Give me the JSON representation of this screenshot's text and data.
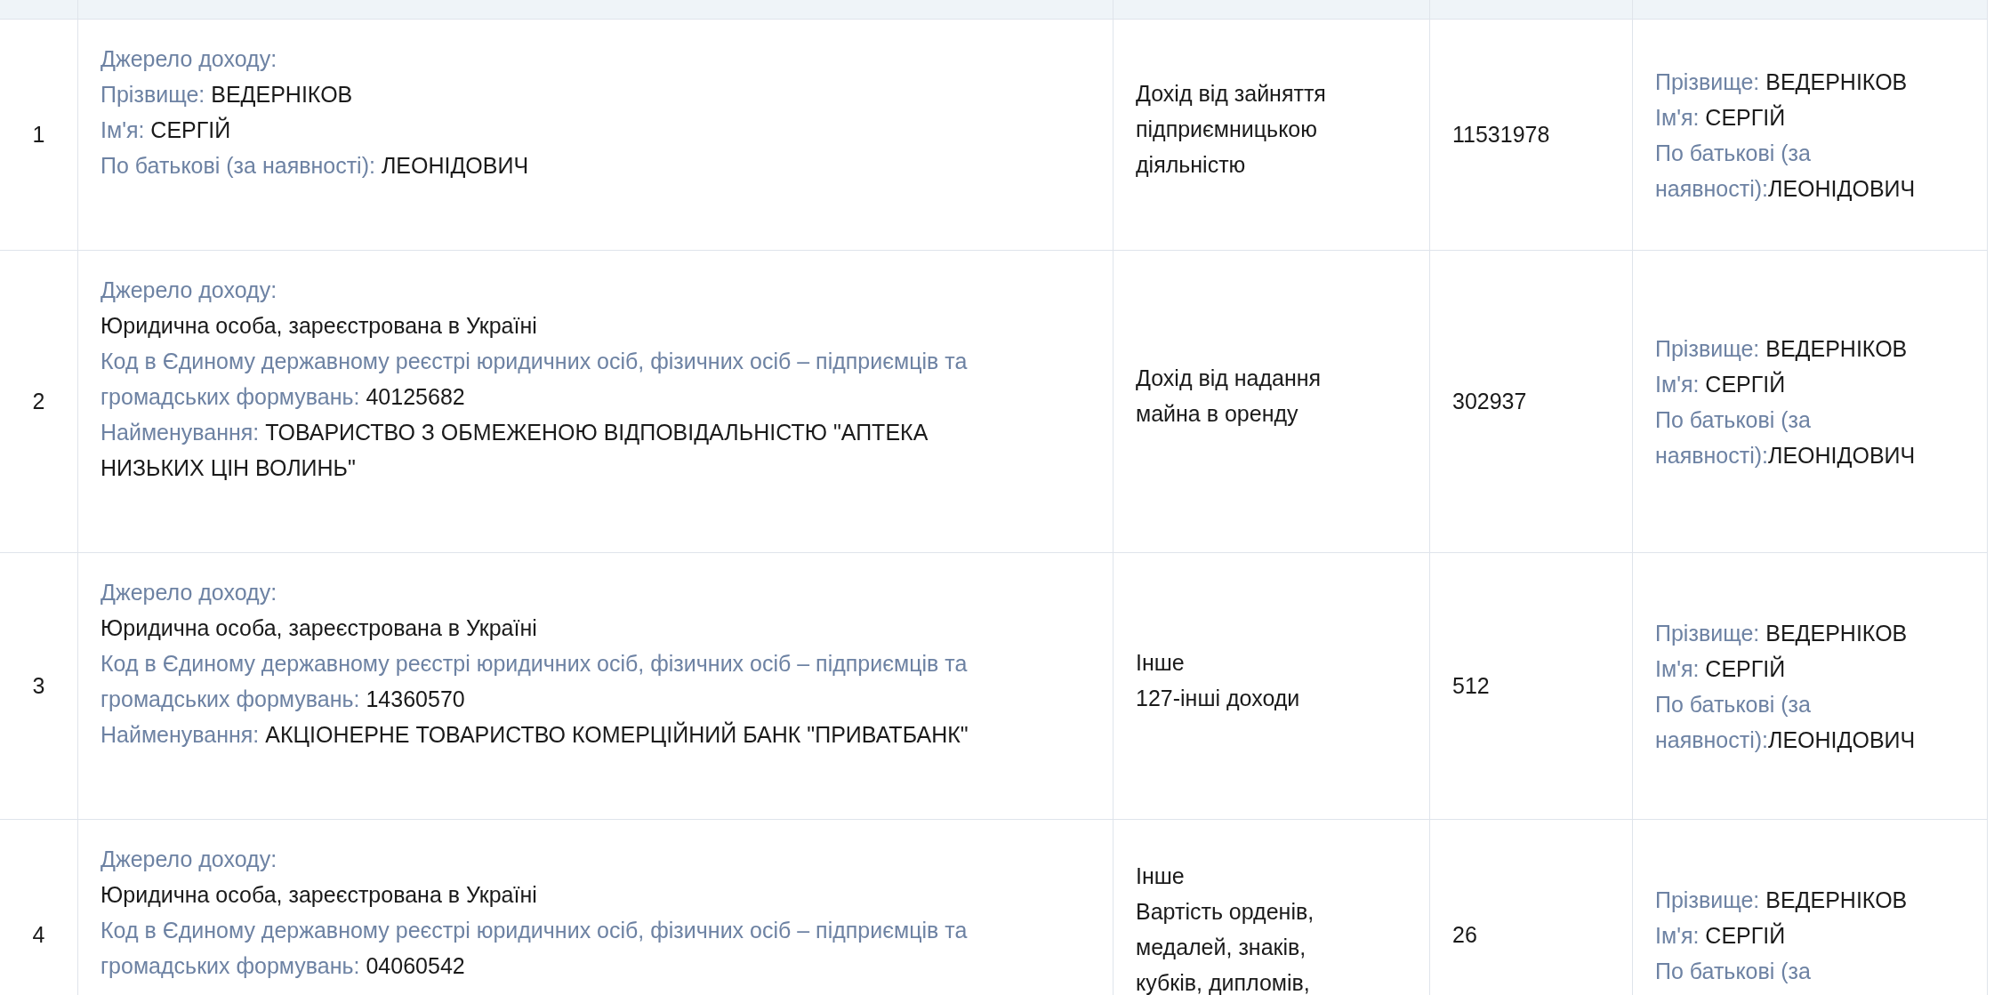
{
  "table": {
    "rows": [
      {
        "number": "1",
        "source": [
          {
            "label": "Джерело доходу:"
          },
          {
            "label": "Прізвище:",
            "value": "ВЕДЕРНІКОВ",
            "gap": true
          },
          {
            "label": "Ім'я:",
            "value": "СЕРГІЙ",
            "gap": true
          },
          {
            "label": "По батькові (за наявності):",
            "value": "ЛЕОНІДОВИЧ",
            "gap": true
          }
        ],
        "income_type": [
          "Дохід від зайняття підприємницькою діяльністю"
        ],
        "amount": "11531978",
        "recipient": [
          {
            "label": "Прізвище:",
            "value": "ВЕДЕРНІКОВ",
            "gap": true
          },
          {
            "label": "Ім'я:",
            "value": "СЕРГІЙ",
            "gap": true
          },
          {
            "label": "По батькові (за наявності):",
            "value": "ЛЕОНІДОВИЧ",
            "gap": false
          }
        ]
      },
      {
        "number": "2",
        "source": [
          {
            "label": "Джерело доходу:"
          },
          {
            "value": "Юридична особа, зареєстрована в Україні"
          },
          {
            "label": "Код в Єдиному державному реєстрі юридичних осіб, фізичних осіб – підприємців та громадських формувань:",
            "value": "40125682",
            "gap": true
          },
          {
            "label": "Найменування:",
            "value": "ТОВАРИСТВО З ОБМЕЖЕНОЮ ВІДПОВІДАЛЬНІСТЮ \"АПТЕКА НИЗЬКИХ ЦІН ВОЛИНЬ\"",
            "gap": true
          }
        ],
        "income_type": [
          "Дохід від надання майна в оренду"
        ],
        "amount": "302937",
        "recipient": [
          {
            "label": "Прізвище:",
            "value": "ВЕДЕРНІКОВ",
            "gap": true
          },
          {
            "label": "Ім'я:",
            "value": "СЕРГІЙ",
            "gap": true
          },
          {
            "label": "По батькові (за наявності):",
            "value": "ЛЕОНІДОВИЧ",
            "gap": false
          }
        ]
      },
      {
        "number": "3",
        "source": [
          {
            "label": "Джерело доходу:"
          },
          {
            "value": "Юридична особа, зареєстрована в Україні"
          },
          {
            "label": "Код в Єдиному державному реєстрі юридичних осіб, фізичних осіб – підприємців та громадських формувань:",
            "value": "14360570",
            "gap": true
          },
          {
            "label": "Найменування:",
            "value": "АКЦІОНЕРНЕ ТОВАРИСТВО КОМЕРЦІЙНИЙ БАНК \"ПРИВАТБАНК\"",
            "gap": true
          }
        ],
        "income_type": [
          "Інше",
          "127-інші доходи"
        ],
        "amount": "512",
        "recipient": [
          {
            "label": "Прізвище:",
            "value": "ВЕДЕРНІКОВ",
            "gap": true
          },
          {
            "label": "Ім'я:",
            "value": "СЕРГІЙ",
            "gap": true
          },
          {
            "label": "По батькові (за наявності):",
            "value": "ЛЕОНІДОВИЧ",
            "gap": false
          }
        ]
      },
      {
        "number": "4",
        "source": [
          {
            "label": "Джерело доходу:"
          },
          {
            "value": "Юридична особа, зареєстрована в Україні"
          },
          {
            "label": "Код в Єдиному державному реєстрі юридичних осіб, фізичних осіб – підприємців та громадських формувань:",
            "value": "04060542",
            "gap": true
          }
        ],
        "income_type": [
          "Інше",
          "Вартість орденів, медалей, знаків, кубків, дипломів,"
        ],
        "amount": "26",
        "recipient": [
          {
            "label": "Прізвище:",
            "value": "ВЕДЕРНІКОВ",
            "gap": true
          },
          {
            "label": "Ім'я:",
            "value": "СЕРГІЙ",
            "gap": true
          },
          {
            "label": "По батькові (за"
          }
        ]
      }
    ]
  }
}
